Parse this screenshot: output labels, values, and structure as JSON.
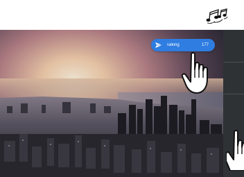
{
  "header": {
    "music_icon": "music-notes-icon"
  },
  "badge": {
    "label": "Talking",
    "count": "177",
    "icon": "paper-plane-icon",
    "color": "#2f7de1"
  },
  "photo": {
    "subject": "city-skyline"
  },
  "gestures": {
    "tap_icon": "pointing-hand-icon",
    "swipe_icon": "pointing-hand-icon"
  }
}
